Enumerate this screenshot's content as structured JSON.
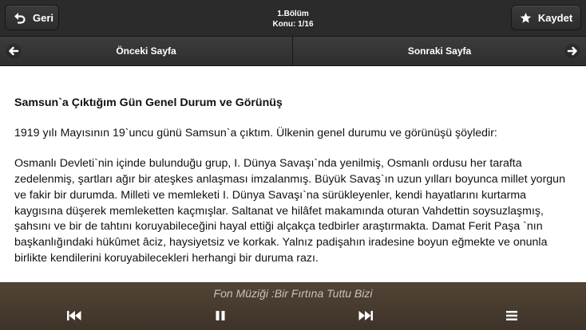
{
  "header": {
    "back_label": "Geri",
    "section": "1.Bölüm",
    "topic": "Konu: 1/16",
    "save_label": "Kaydet"
  },
  "nav": {
    "prev_label": "Önceki Sayfa",
    "next_label": "Sonraki Sayfa"
  },
  "content": {
    "title": "Samsun`a Çıktığım Gün Genel Durum ve Görünüş",
    "paragraphs": [
      "1919 yılı Mayısının 19`uncu günü Samsun`a çıktım. Ülkenin genel durumu ve görünüşü şöyledir:",
      "Osmanlı Devleti`nin içinde bulunduğu grup, I. Dünya Savaşı`nda yenilmiş, Osmanlı ordusu her tarafta zedelenmiş, şartları ağır bir ateşkes anlaşması imzalanmış. Büyük Savaş`ın uzun yılları boyunca millet yorgun ve fakir bir durumda. Milleti ve memleketi I. Dünya Savaşı`na sürükleyenler, kendi hayatlarını kurtarma kaygısına düşerek memleketten kaçmışlar. Saltanat ve hilâfet makamında oturan Vahdettin soysuzlaşmış, şahsını ve bir de tahtını koruyabileceğini hayal ettiği alçakça tedbirler araştırmakta. Damat Ferit Paşa `nın başkanlığındaki hükûmet âciz, haysiyetsiz ve korkak. Yalnız padişahın iradesine boyun eğmekte ve onunla birlikte kendilerini koruyabilecekleri herhangi bir duruma razı."
    ]
  },
  "footer": {
    "music_text": "Fon Müziği :Bir Fırtına Tuttu Bizi"
  },
  "icons": {
    "back": "undo-arrow-icon",
    "save": "star-icon",
    "prev": "arrow-left-icon",
    "next": "arrow-right-icon",
    "rewind": "skip-back-icon",
    "pause": "pause-icon",
    "forward": "skip-forward-icon",
    "menu": "menu-icon"
  }
}
